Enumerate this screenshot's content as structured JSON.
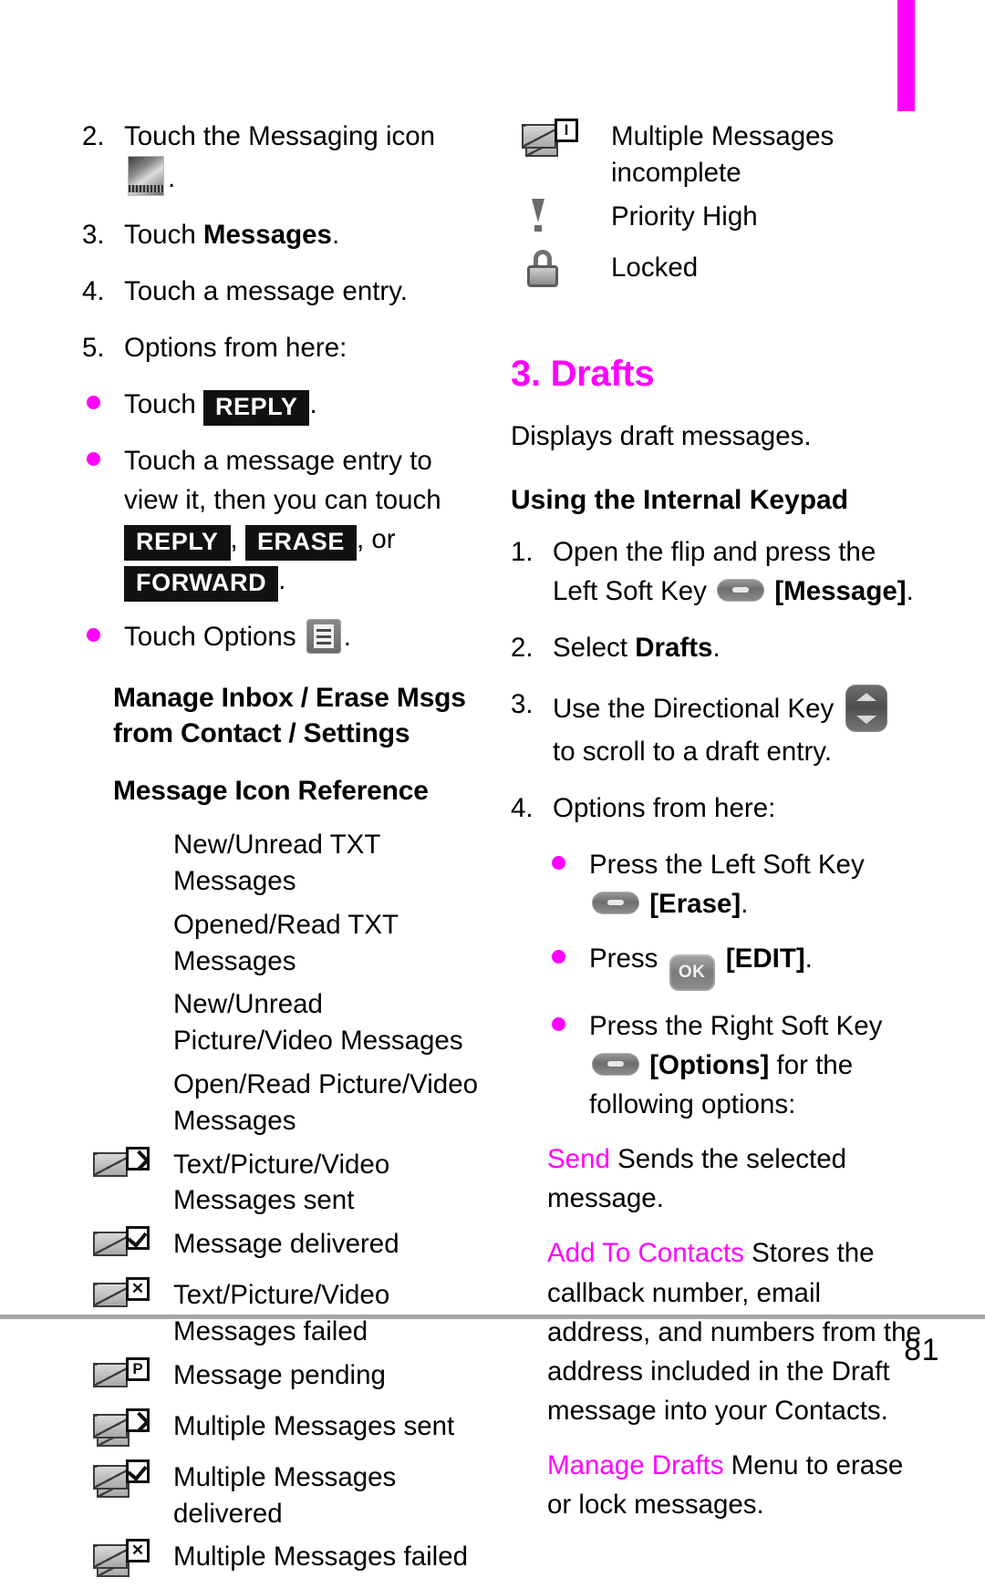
{
  "page": {
    "number": "81",
    "tab_color": "#ff00ff",
    "rule_color": "#a6a6a6"
  },
  "left_column": {
    "steps": [
      {
        "num": "2.",
        "text_before": "Touch the Messaging icon",
        "icon": "messaging-icon",
        "text_after": "."
      },
      {
        "num": "3.",
        "text_before": "Touch ",
        "bold": "Messages",
        "text_after": "."
      },
      {
        "num": "4.",
        "text_before": "Touch a message entry.",
        "bold": "",
        "text_after": ""
      },
      {
        "num": "5.",
        "text_before": "Options from here:",
        "bold": "",
        "text_after": ""
      }
    ],
    "bullets": [
      {
        "lead": "Touch",
        "chip1": "REPLY",
        "tail": "."
      },
      {
        "line1": "Touch a message entry to view it,",
        "line2_lead": "then you can touch",
        "chip1": "REPLY",
        "comma": ",",
        "chip2": "ERASE",
        "mid": ", or",
        "chip3": "FORWARD",
        "tail": "."
      },
      {
        "lead": "Touch Options",
        "icon": "options-icon",
        "tail": "."
      }
    ],
    "subheads": {
      "manage": "Manage Inbox / Erase Msgs from Contact / Settings",
      "icon_reference": "Message Icon Reference"
    },
    "icon_reference": [
      {
        "icon": "none",
        "label": "New/Unread TXT Messages"
      },
      {
        "icon": "none",
        "label": "Opened/Read TXT Messages"
      },
      {
        "icon": "none",
        "label": "New/Unread Picture/Video Messages"
      },
      {
        "icon": "none",
        "label": "Open/Read Picture/Video Messages"
      },
      {
        "icon": "envelope-sent-icon",
        "label": "Text/Picture/Video Messages sent"
      },
      {
        "icon": "envelope-delivered-icon",
        "label": "Message delivered"
      },
      {
        "icon": "envelope-failed-icon",
        "label": "Text/Picture/Video Messages failed"
      },
      {
        "icon": "envelope-pending-icon",
        "label": "Message pending"
      },
      {
        "icon": "multi-envelope-sent-icon",
        "label": "Multiple Messages sent"
      },
      {
        "icon": "multi-envelope-delivered-icon",
        "label": "Multiple Messages delivered"
      },
      {
        "icon": "multi-envelope-failed-icon",
        "label": "Multiple Messages failed"
      }
    ]
  },
  "right_column": {
    "icon_reference": [
      {
        "icon": "multi-envelope-incomplete-icon",
        "label": "Multiple Messages incomplete"
      },
      {
        "icon": "priority-high-icon",
        "label": "Priority High"
      },
      {
        "icon": "lock-icon",
        "label": "Locked"
      }
    ],
    "section": {
      "title": "3. Drafts",
      "description": "Displays draft messages."
    },
    "keypad_heading": "Using the Internal Keypad",
    "steps": [
      {
        "num": "1.",
        "text_before": "Open the flip and press the Left Soft Key",
        "key": "left-soft-key",
        "bracket": "[Message]",
        "text_after": "."
      },
      {
        "num": "2.",
        "text_before": "Select ",
        "bold": "Drafts",
        "text_after": "."
      },
      {
        "num": "3.",
        "text_before": "Use the Directional Key",
        "key": "directional-key",
        "text_after": "to scroll to a draft entry."
      },
      {
        "num": "4.",
        "text_before": "Options from here:",
        "text_after": ""
      }
    ],
    "bullets": [
      {
        "lead": "Press the Left Soft Key",
        "key": "left-soft-key",
        "bracket": "[Erase]",
        "tail": "."
      },
      {
        "lead": "Press",
        "key": "ok-key",
        "bracket": "[EDIT]",
        "tail": "."
      },
      {
        "lead": "Press the Right Soft Key",
        "key": "right-soft-key",
        "bracket": "[Options]",
        "tail": " for the following options:"
      }
    ],
    "options": [
      {
        "term": "Send",
        "desc": " Sends the selected message."
      },
      {
        "term": "Add To Contacts",
        "desc": " Stores the callback number, email address, and numbers from the address included in the Draft message into your Contacts."
      },
      {
        "term": "Manage Drafts",
        "desc": " Menu to erase or lock messages."
      }
    ]
  }
}
